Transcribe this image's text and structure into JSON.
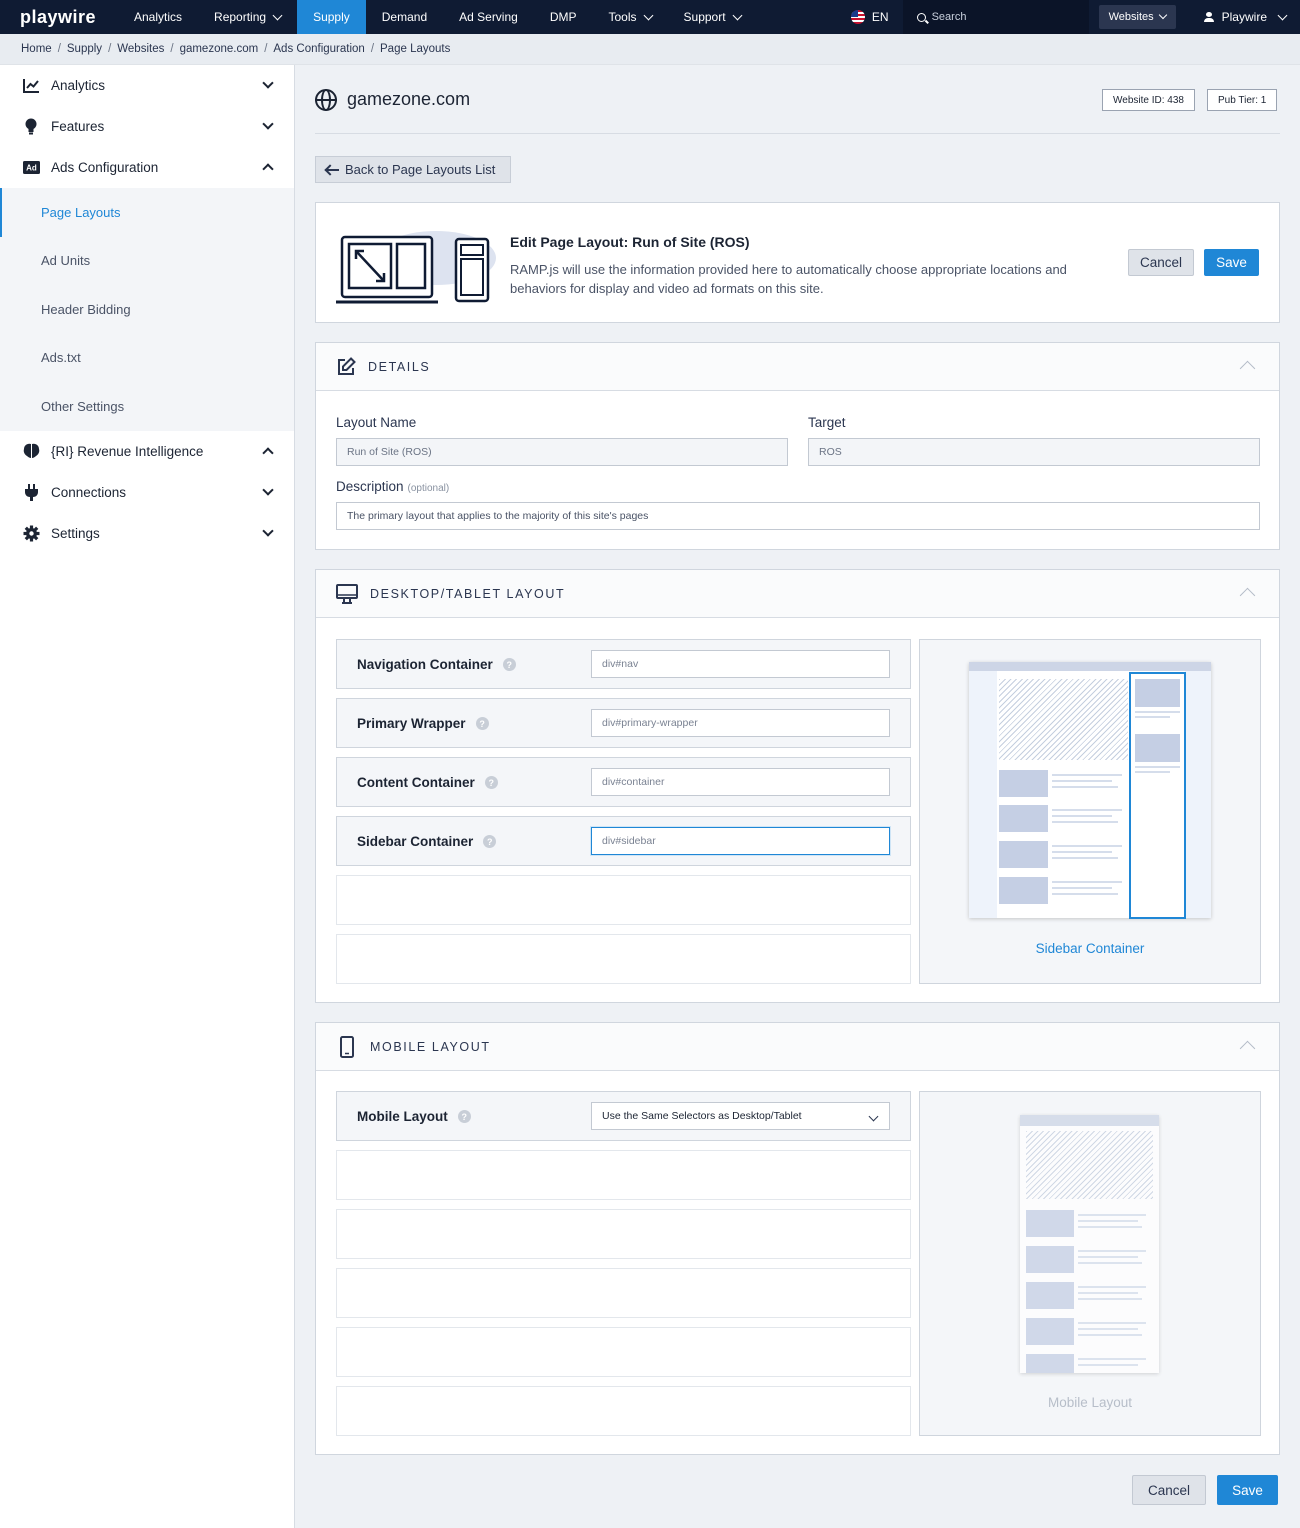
{
  "topnav": {
    "logo": "playwire",
    "items": [
      {
        "label": "Analytics",
        "dropdown": false,
        "active": false
      },
      {
        "label": "Reporting",
        "dropdown": true,
        "active": false
      },
      {
        "label": "Supply",
        "dropdown": false,
        "active": true
      },
      {
        "label": "Demand",
        "dropdown": false,
        "active": false
      },
      {
        "label": "Ad Serving",
        "dropdown": false,
        "active": false
      },
      {
        "label": "DMP",
        "dropdown": false,
        "active": false
      },
      {
        "label": "Tools",
        "dropdown": true,
        "active": false
      },
      {
        "label": "Support",
        "dropdown": true,
        "active": false
      }
    ],
    "language": "EN",
    "search_placeholder": "Search",
    "websites_label": "Websites",
    "user_label": "Playwire"
  },
  "breadcrumb": [
    "Home",
    "Supply",
    "Websites",
    "gamezone.com",
    "Ads Configuration",
    "Page Layouts"
  ],
  "sidebar": {
    "groups": [
      {
        "label": "Analytics",
        "icon": "chart-line-icon",
        "expanded": false
      },
      {
        "label": "Features",
        "icon": "lightbulb-icon",
        "expanded": false
      },
      {
        "label": "Ads Configuration",
        "icon": "ad-badge-icon",
        "expanded": true
      }
    ],
    "sub_items": [
      "Page Layouts",
      "Ad Units",
      "Header Bidding",
      "Ads.txt",
      "Other Settings"
    ],
    "active_sub": "Page Layouts",
    "groups_after": [
      {
        "label": "{RI} Revenue Intelligence",
        "icon": "brain-icon",
        "expanded": true
      },
      {
        "label": "Connections",
        "icon": "plug-icon",
        "expanded": false
      },
      {
        "label": "Settings",
        "icon": "gear-icon",
        "expanded": false
      }
    ]
  },
  "site": {
    "name": "gamezone.com",
    "website_id": "Website ID: 438",
    "pub_tier": "Pub Tier: 1"
  },
  "back_button": "Back to Page Layouts List",
  "edit_card": {
    "title": "Edit Page Layout: Run of Site (ROS)",
    "description": "RAMP.js will use the information provided here to automatically choose appropriate locations and behaviors for display and video ad formats on this site.",
    "cancel": "Cancel",
    "save": "Save"
  },
  "details": {
    "heading": "DETAILS",
    "layout_name_label": "Layout Name",
    "layout_name_value": "Run of Site (ROS)",
    "target_label": "Target",
    "target_value": "ROS",
    "description_label": "Description",
    "description_optional": "(optional)",
    "description_value": "The primary layout that applies to the majority of this site's pages"
  },
  "desktop": {
    "heading": "DESKTOP/TABLET LAYOUT",
    "rows": [
      {
        "label": "Navigation Container",
        "value": "div#nav"
      },
      {
        "label": "Primary Wrapper",
        "value": "div#primary-wrapper"
      },
      {
        "label": "Content Container",
        "value": "div#container"
      },
      {
        "label": "Sidebar Container",
        "value": "div#sidebar"
      }
    ],
    "preview_caption": "Sidebar Container"
  },
  "mobile": {
    "heading": "MOBILE LAYOUT",
    "row_label": "Mobile Layout",
    "select_value": "Use the Same Selectors as Desktop/Tablet",
    "preview_caption": "Mobile Layout"
  },
  "footer": {
    "cancel": "Cancel",
    "save": "Save"
  },
  "colors": {
    "accent": "#1f87d6",
    "nav_bg": "#0f1b33"
  }
}
